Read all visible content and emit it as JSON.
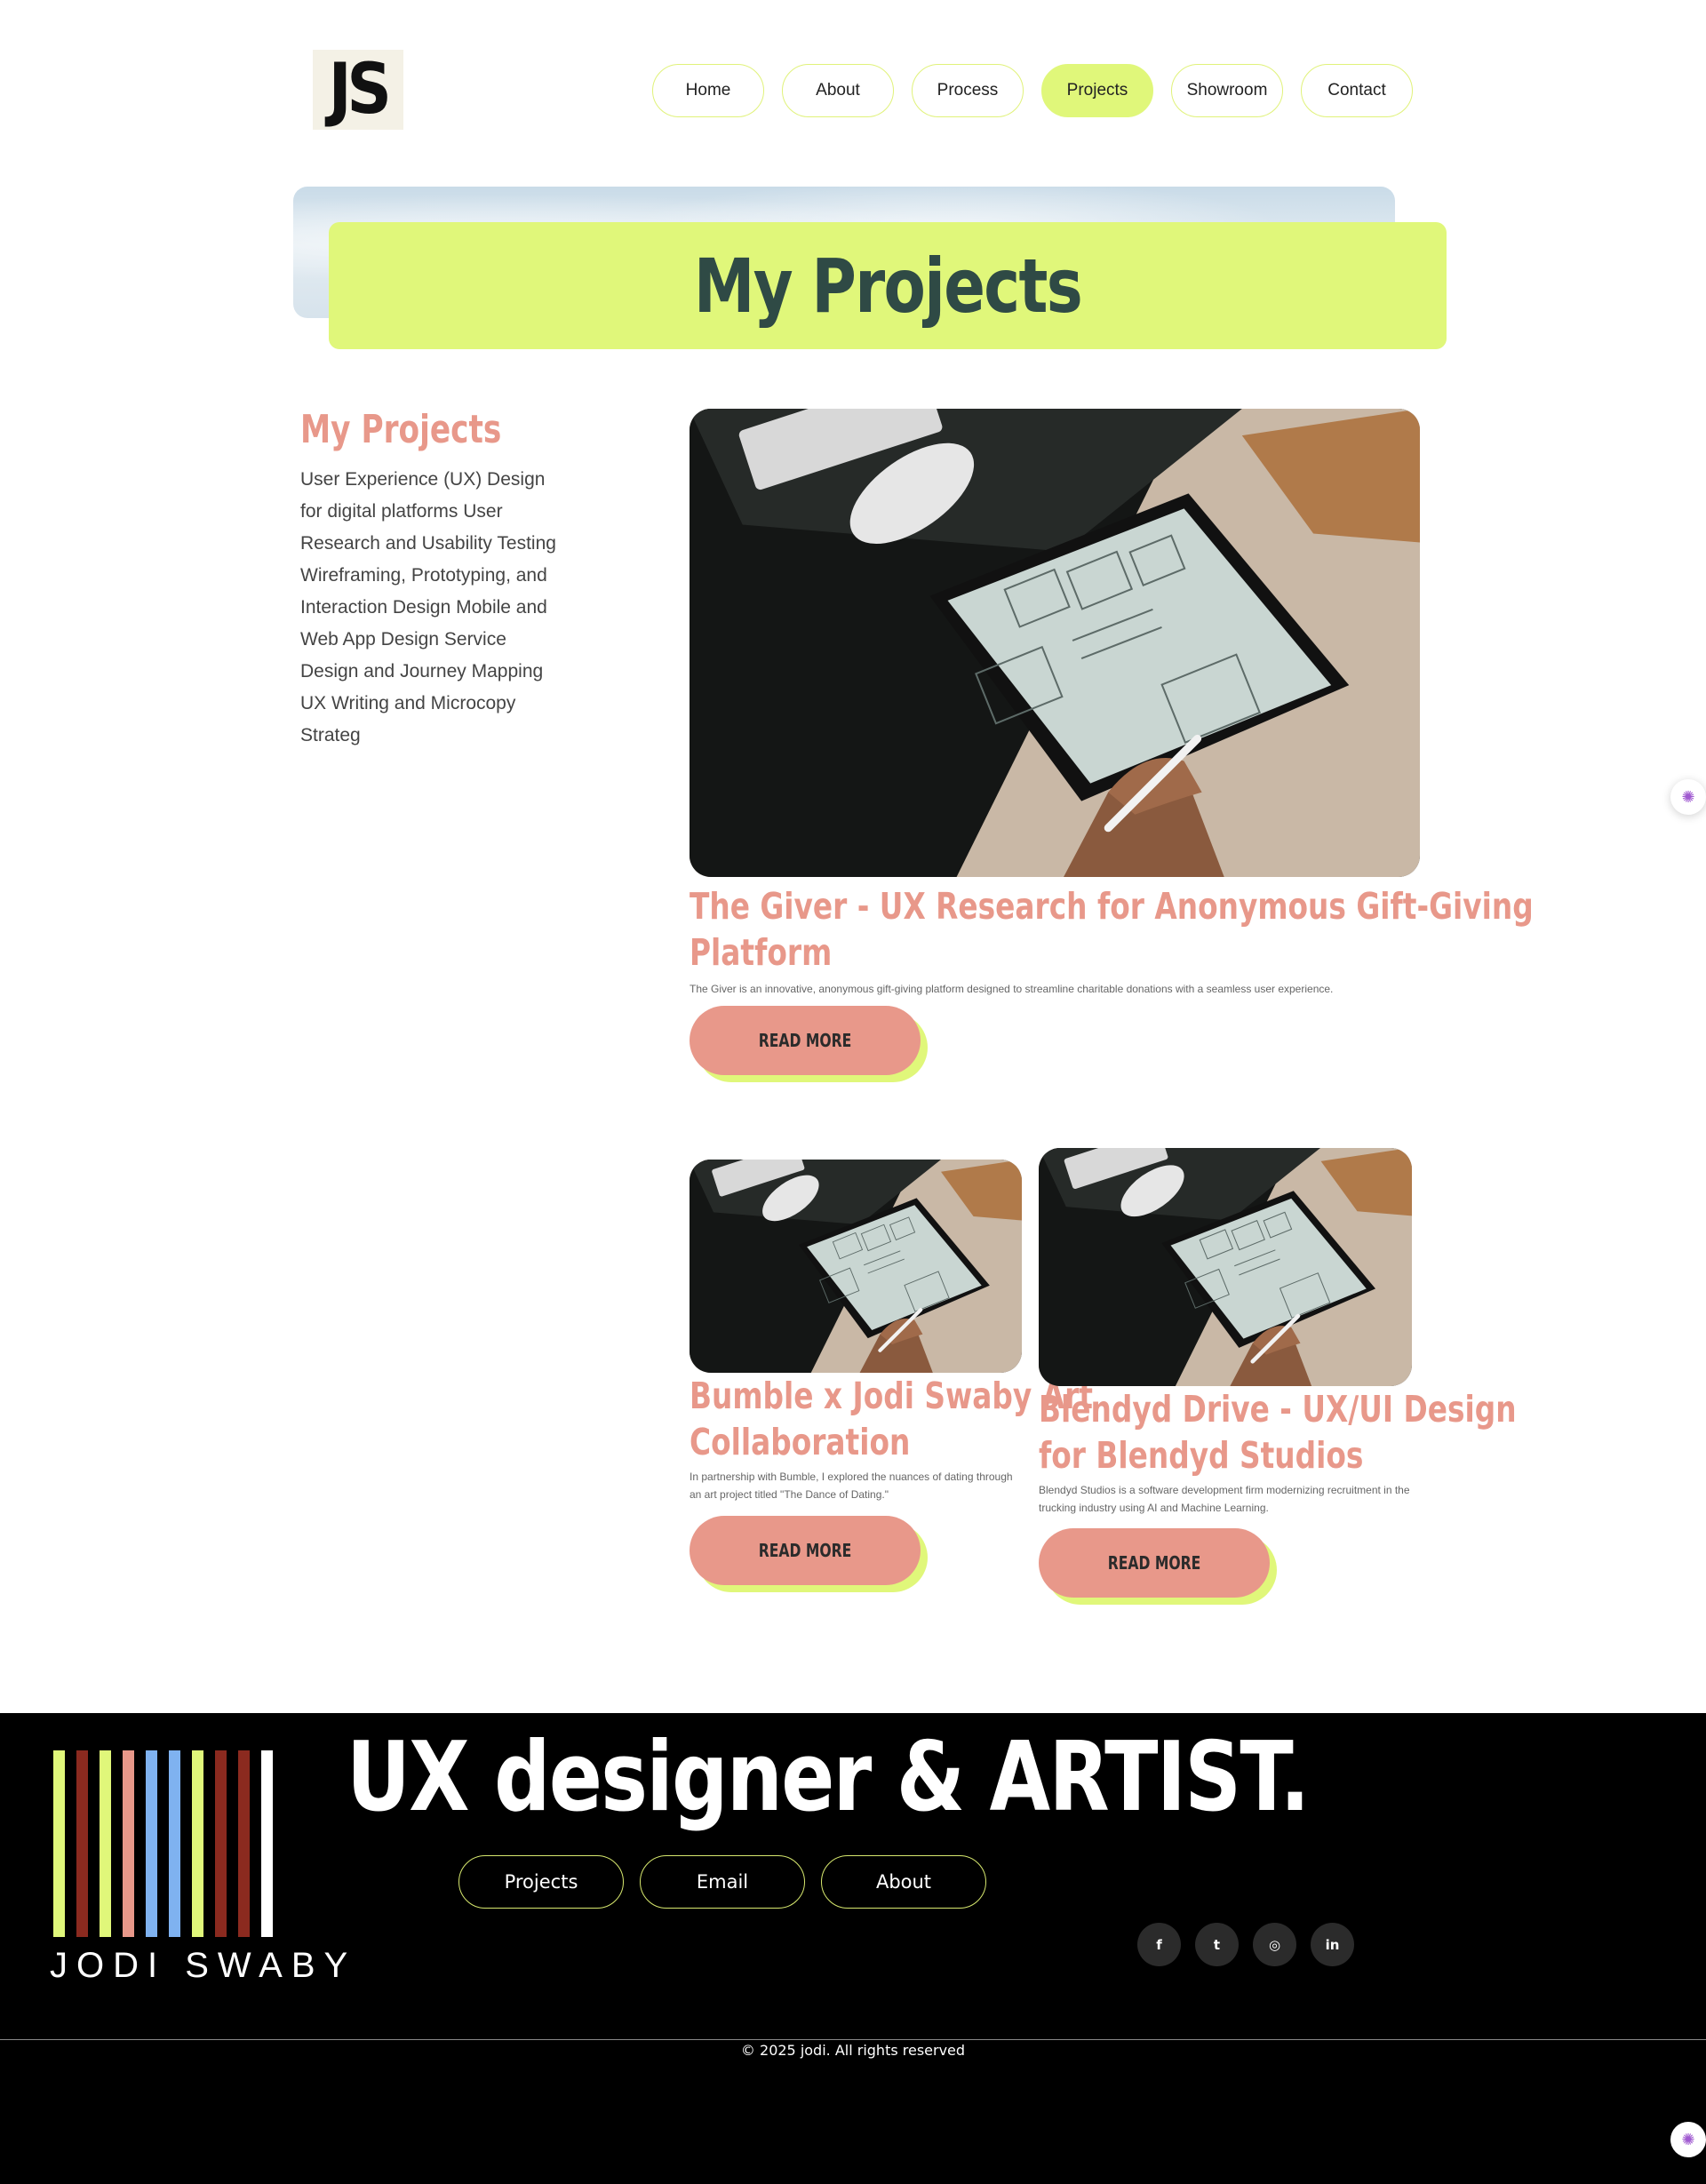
{
  "header": {
    "logo_text": "JS",
    "nav": [
      {
        "label": "Home",
        "active": false
      },
      {
        "label": "About",
        "active": false
      },
      {
        "label": "Process",
        "active": false
      },
      {
        "label": "Projects",
        "active": true
      },
      {
        "label": "Showroom",
        "active": false
      },
      {
        "label": "Contact",
        "active": false
      }
    ]
  },
  "hero": {
    "title": "My Projects"
  },
  "sidebar": {
    "title": "My Projects",
    "text": "User Experience (UX) Design for digital platforms User Research and Usability Testing Wireframing, Prototyping, and Interaction Design Mobile and Web App Design Service Design and Journey Mapping UX Writing and Microcopy Strateg"
  },
  "projects": [
    {
      "title_line1": "The Giver - UX Research for Anonymous Gift-Giving",
      "title_line2": "Platform",
      "description": "The Giver is an innovative, anonymous gift-giving platform designed to streamline charitable donations with a seamless user experience.",
      "button_label": "READ MORE"
    },
    {
      "title_line1": "Bumble x Jodi Swaby Art",
      "title_line2": "Collaboration",
      "description_line1": "In partnership with Bumble, I explored the nuances of dating through",
      "description_line2": "an art project titled \"The Dance of Dating.\"",
      "button_label": "READ MORE"
    },
    {
      "title_line1": "Blendyd Drive - UX/UI Design",
      "title_line2": "for Blendyd Studios",
      "description_line1": "Blendyd Studios is a software development firm modernizing recruitment in the",
      "description_line2": "trucking industry using AI and Machine Learning.",
      "button_label": "READ MORE"
    }
  ],
  "footer": {
    "brand": "JODI SWABY",
    "headline": "UX designer & ARTIST.",
    "links": [
      "Projects",
      "Email",
      "About"
    ],
    "socials": [
      {
        "icon": "facebook-icon",
        "glyph": "f"
      },
      {
        "icon": "twitter-icon",
        "glyph": "t"
      },
      {
        "icon": "instagram-icon",
        "glyph": "◎"
      },
      {
        "icon": "linkedin-icon",
        "glyph": "in"
      }
    ],
    "copyright": "© 2025 jodi. All rights reserved",
    "stripe_colors": [
      "#e0f77a",
      "#8b2a1f",
      "#e0f77a",
      "#e8988a",
      "#7fb2f0",
      "#7fb2f0",
      "#e0f77a",
      "#8b2a1f",
      "#8b2a1f",
      "#ffffff"
    ]
  },
  "colors": {
    "accent_lime": "#e0f77a",
    "accent_salmon": "#e8988a",
    "heading_dark": "#2f4a45"
  }
}
